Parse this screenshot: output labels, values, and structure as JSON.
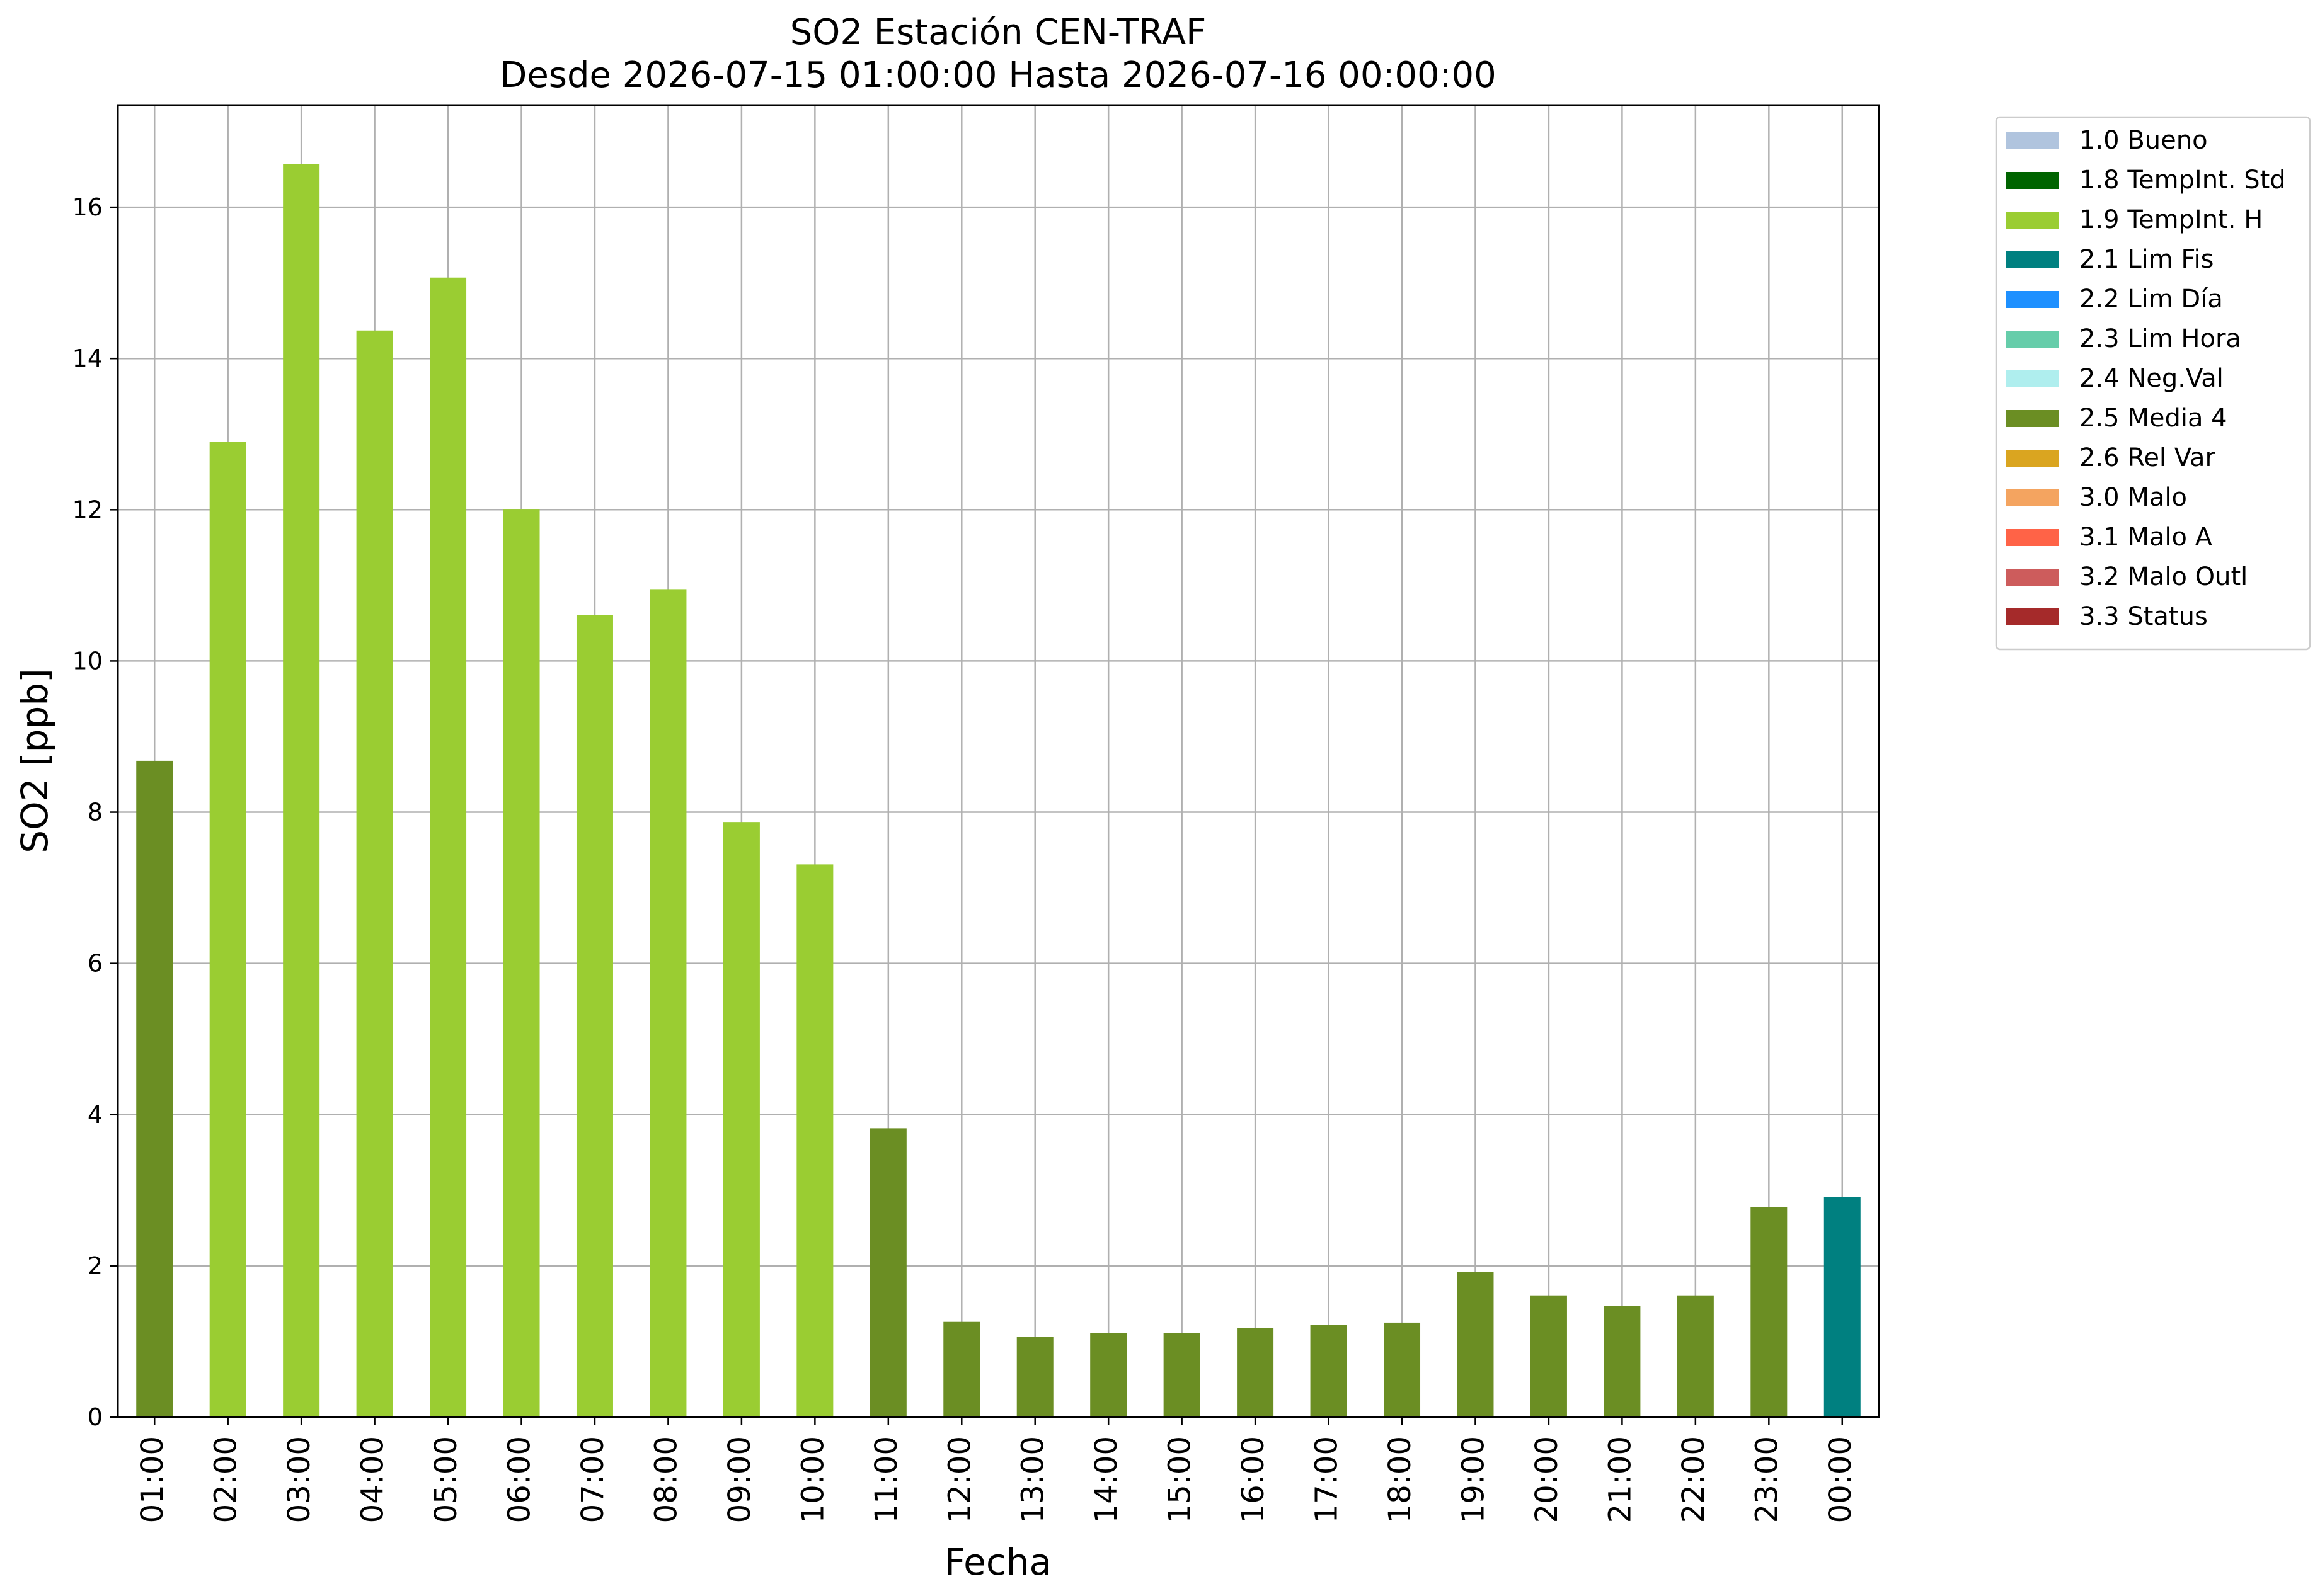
{
  "chart_data": {
    "type": "bar",
    "title": "SO2 Estación CEN-TRAF",
    "subtitle": "Desde 2026-07-15 01:00:00 Hasta 2026-07-16 00:00:00",
    "xlabel": "Fecha",
    "ylabel": "SO2 [ppb]",
    "ylim": [
      0,
      17.35
    ],
    "yticks": [
      0,
      2,
      4,
      6,
      8,
      10,
      12,
      14,
      16
    ],
    "grid": true,
    "legend_position": "outside-top-right",
    "categories": [
      "01:00",
      "02:00",
      "03:00",
      "04:00",
      "05:00",
      "06:00",
      "07:00",
      "08:00",
      "09:00",
      "10:00",
      "11:00",
      "12:00",
      "13:00",
      "14:00",
      "15:00",
      "16:00",
      "17:00",
      "18:00",
      "19:00",
      "20:00",
      "21:00",
      "22:00",
      "23:00",
      "00:00"
    ],
    "values": [
      8.68,
      12.9,
      16.57,
      14.37,
      15.07,
      12.01,
      10.61,
      10.95,
      7.87,
      7.31,
      3.82,
      1.26,
      1.06,
      1.11,
      1.11,
      1.18,
      1.22,
      1.25,
      1.92,
      1.61,
      1.47,
      1.61,
      2.78,
      2.91
    ],
    "flags": [
      "2.5 Media 4",
      "1.9 TempInt. H",
      "1.9 TempInt. H",
      "1.9 TempInt. H",
      "1.9 TempInt. H",
      "1.9 TempInt. H",
      "1.9 TempInt. H",
      "1.9 TempInt. H",
      "1.9 TempInt. H",
      "1.9 TempInt. H",
      "2.5 Media 4",
      "2.5 Media 4",
      "2.5 Media 4",
      "2.5 Media 4",
      "2.5 Media 4",
      "2.5 Media 4",
      "2.5 Media 4",
      "2.5 Media 4",
      "2.5 Media 4",
      "2.5 Media 4",
      "2.5 Media 4",
      "2.5 Media 4",
      "2.5 Media 4",
      "2.1 Lim Fis"
    ],
    "legend": [
      {
        "label": "1.0 Bueno",
        "color": "#b0c4de"
      },
      {
        "label": "1.8 TempInt. Std",
        "color": "#006400"
      },
      {
        "label": "1.9 TempInt. H",
        "color": "#9acd32"
      },
      {
        "label": "2.1 Lim Fis",
        "color": "#008080"
      },
      {
        "label": "2.2 Lim Día",
        "color": "#1e90ff"
      },
      {
        "label": "2.3 Lim Hora",
        "color": "#66cdaa"
      },
      {
        "label": "2.4 Neg.Val",
        "color": "#afeeee"
      },
      {
        "label": "2.5 Media 4",
        "color": "#6b8e23"
      },
      {
        "label": "2.6 Rel Var",
        "color": "#daa520"
      },
      {
        "label": "3.0 Malo",
        "color": "#f4a460"
      },
      {
        "label": "3.1 Malo A",
        "color": "#ff6347"
      },
      {
        "label": "3.2 Malo Outl",
        "color": "#cd5c5c"
      },
      {
        "label": "3.3 Status",
        "color": "#a52a2a"
      }
    ]
  }
}
